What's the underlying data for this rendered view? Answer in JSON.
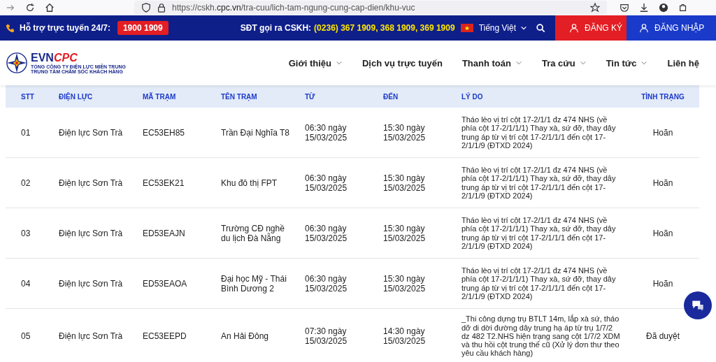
{
  "browser": {
    "url_host": "https://cskh.",
    "url_domain": "cpc.vn",
    "url_path": "/tra-cuu/lich-tam-ngung-cung-cap-dien/khu-vuc"
  },
  "topbar": {
    "support_label": "Hỗ trợ trực tuyến 24/7:",
    "hotline": "1900 1909",
    "cskh_label": "SĐT gọi ra CSKH:",
    "cskh_numbers": "(0236) 367 1909, 368 1909, 369 1909",
    "language": "Tiếng Việt",
    "register": "ĐĂNG KÝ",
    "login": "ĐĂNG NHẬP"
  },
  "header": {
    "logo_evn": "EVN",
    "logo_cpc": "CPC",
    "logo_line1": "TỔNG CÔNG TY ĐIỆN LỰC MIỀN TRUNG",
    "logo_line2": "TRUNG TÂM CHĂM SÓC KHÁCH HÀNG",
    "nav": [
      {
        "label": "Giới thiệu",
        "dropdown": true
      },
      {
        "label": "Dịch vụ trực tuyến",
        "dropdown": false
      },
      {
        "label": "Thanh toán",
        "dropdown": true
      },
      {
        "label": "Tra cứu",
        "dropdown": true
      },
      {
        "label": "Tin tức",
        "dropdown": true
      },
      {
        "label": "Liên hệ",
        "dropdown": false
      }
    ]
  },
  "table": {
    "columns": [
      "STT",
      "ĐIỆN LỰC",
      "MÃ TRẠM",
      "TÊN TRẠM",
      "TỪ",
      "ĐẾN",
      "LÝ DO",
      "TÌNH TRẠNG"
    ],
    "rows": [
      [
        "01",
        "Điện lực Sơn Trà",
        "EC53EH85",
        "Trần Đại Nghĩa T8",
        "06:30 ngày 15/03/2025",
        "15:30 ngày 15/03/2025",
        "Tháo lèo vị trí cột 17-2/1/1 đz 474 NHS (về phía cột 17-2/1/1/1) Thay xà, sứ đỡ, thay dây trung áp từ vị trí cột 17-2/1/1/1 đến cột 17-2/1/1/9 (ĐTXD 2024)",
        "Hoãn"
      ],
      [
        "02",
        "Điện lực Sơn Trà",
        "EC53EK21",
        "Khu đô thị FPT",
        "06:30 ngày 15/03/2025",
        "15:30 ngày 15/03/2025",
        "Tháo lèo vị trí cột 17-2/1/1 đz 474 NHS (về phía cột 17-2/1/1/1) Thay xà, sứ đỡ, thay dây trung áp từ vị trí cột 17-2/1/1/1 đến cột 17-2/1/1/9 (ĐTXD 2024)",
        "Hoãn"
      ],
      [
        "03",
        "Điện lực Sơn Trà",
        "ED53EAJN",
        "Trường CĐ nghề du lịch Đà Nẵng",
        "06:30 ngày 15/03/2025",
        "15:30 ngày 15/03/2025",
        "Tháo lèo vị trí cột 17-2/1/1 đz 474 NHS (về phía cột 17-2/1/1/1) Thay xà, sứ đỡ, thay dây trung áp từ vị trí cột 17-2/1/1/1 đến cột 17-2/1/1/9 (ĐTXD 2024)",
        "Hoãn"
      ],
      [
        "04",
        "Điện lực Sơn Trà",
        "ED53EAOA",
        "Đại học Mỹ - Thái Bình Dương 2",
        "06:30 ngày 15/03/2025",
        "15:30 ngày 15/03/2025",
        "Tháo lèo vị trí cột 17-2/1/1 đz 474 NHS (về phía cột 17-2/1/1/1) Thay xà, sứ đỡ, thay dây trung áp từ vị trí cột 17-2/1/1/1 đến cột 17-2/1/1/9 (ĐTXD 2024)",
        "Hoãn"
      ],
      [
        "05",
        "Điện lực Sơn Trà",
        "EC53EEPD",
        "An Hải Đông",
        "07:30 ngày 15/03/2025",
        "14:30 ngày 15/03/2025",
        "_Thi công dựng trụ BTLT 14m, lắp xà sứ, tháo dỡ di dời đường dây trung hạ áp từ trụ 1/7/2 dz 482 T2.NHS hiện trạng sang cột 1/7/2 XDM và thu hồi cột trung thế cũ (Xử lý đơn thư theo yêu cầu khách hàng)",
        "Đã duyệt"
      ]
    ]
  }
}
